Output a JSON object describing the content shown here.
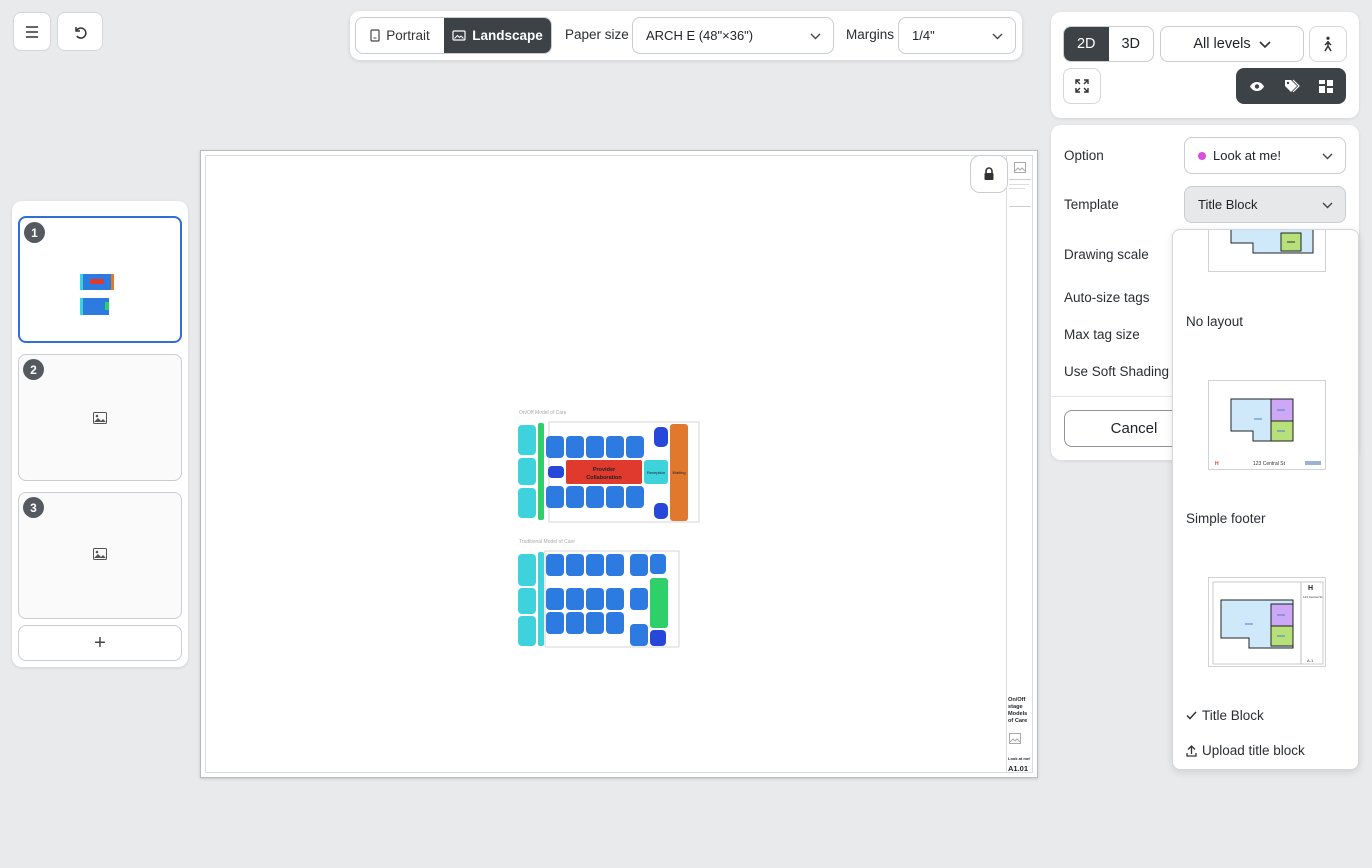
{
  "topleft": {
    "menu_icon": "hamburger-icon",
    "undo_icon": "undo-icon"
  },
  "toolbar": {
    "portrait_label": "Portrait",
    "landscape_label": "Landscape",
    "paper_size_label": "Paper size",
    "paper_size_value": "ARCH E (48\"×36\")",
    "margins_label": "Margins",
    "margins_value": "1/4\""
  },
  "pages_panel": {
    "pages": [
      {
        "number": "1"
      },
      {
        "number": "2"
      },
      {
        "number": "3"
      }
    ],
    "add_label": "+"
  },
  "sheet": {
    "plan1_title": "On/Off Model of Care",
    "plan2_title": "Traditional Model of Care",
    "collab_label_1": "Provider",
    "collab_label_2": "Collaboration",
    "reception_label": "Reception",
    "waiting_label": "Waiting",
    "title_block_name": "On/Off stage Models of Care",
    "title_block_option": "Look at me!",
    "sheet_number": "A1.01"
  },
  "view_panel": {
    "mode_2d": "2D",
    "mode_3d": "3D",
    "levels_value": "All levels",
    "walk_icon": "walk-icon",
    "expand_icon": "expand-icon",
    "eye_icon": "eye-icon",
    "tag_icon": "tag-icon",
    "layout_icon": "grid-layout-icon"
  },
  "settings": {
    "option_label": "Option",
    "option_value": "Look at me!",
    "option_color": "#d94de0",
    "template_label": "Template",
    "template_value": "Title Block",
    "drawing_scale_label": "Drawing scale",
    "auto_size_tags_label": "Auto-size tags",
    "max_tag_size_label": "Max tag size",
    "soft_shading_label": "Use Soft Shading",
    "cancel_label": "Cancel"
  },
  "template_menu": {
    "items": [
      {
        "label": "No layout"
      },
      {
        "label": "Simple footer"
      },
      {
        "label": "Title Block",
        "selected": true
      }
    ],
    "upload_label": "Upload title block",
    "footer_thumb_text": "123 Central St",
    "titleblock_thumb_text": "123 Central St",
    "titleblock_thumb_num": "A-1"
  },
  "colors": {
    "accent": "#2f6fd6",
    "dark": "#3d4247",
    "cyan_room": "#3ed3dc",
    "blue_room": "#2d7be0",
    "red_room": "#e03a2e",
    "orange_room": "#e0782e",
    "green_room": "#2fcf6a"
  }
}
